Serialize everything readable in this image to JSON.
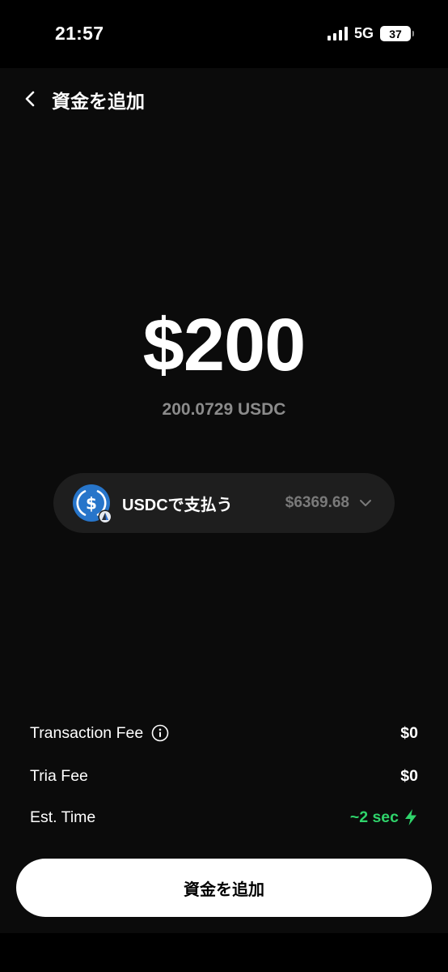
{
  "status_bar": {
    "time": "21:57",
    "network": "5G",
    "battery": "37"
  },
  "header": {
    "title": "資金を追加",
    "back_icon": "chevron-left-icon"
  },
  "amount": {
    "main": "$200",
    "converted": "200.0729 USDC"
  },
  "pay_selector": {
    "coin_icon": "usdc-coin-icon",
    "label": "USDCで支払う",
    "balance": "$6369.68",
    "dropdown_icon": "chevron-down-icon"
  },
  "fees": {
    "transaction_fee_label": "Transaction Fee",
    "transaction_fee_value": "$0",
    "tria_fee_label": "Tria Fee",
    "tria_fee_value": "$0",
    "est_time_label": "Est. Time",
    "est_time_value": "~2 sec"
  },
  "cta": {
    "label": "資金を追加"
  },
  "colors": {
    "accent_green": "#2fd46b",
    "usdc_blue": "#2775ca",
    "background": "#0b0b0b",
    "pill": "#1e1e1e"
  }
}
